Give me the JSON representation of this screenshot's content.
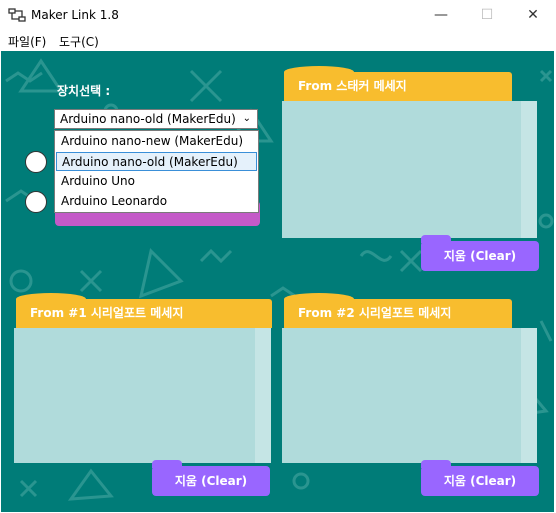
{
  "window": {
    "title": "Maker Link 1.8",
    "minimize_glyph": "—",
    "maximize_glyph": "☐",
    "close_glyph": "✕"
  },
  "menu": [
    "파일(F)",
    "도구(C)"
  ],
  "device": {
    "label": "장치선택 :",
    "selected": "Arduino nano-old (MakerEdu)",
    "chevron": "⌄",
    "options": [
      "Arduino nano-new (MakerEdu)",
      "Arduino nano-old (MakerEdu)",
      "Arduino Uno",
      "Arduino Leonardo"
    ]
  },
  "panels": {
    "sticker": {
      "title": "From 스태커 메세지",
      "clear_label": "지움 (Clear)"
    },
    "serial1": {
      "title": "From #1 시리얼포트 메세지",
      "clear_label": "지움 (Clear)"
    },
    "serial2": {
      "title": "From #2 시리얼포트 메세지",
      "clear_label": "지움 (Clear)"
    }
  },
  "colors": {
    "background": "#007c78",
    "header": "#f8bd2e",
    "panel_body": "#b0dbdb",
    "clear_button": "#9966ff",
    "pink": "#c45ac8"
  },
  "icons": {
    "app": "app-logo-icon"
  }
}
